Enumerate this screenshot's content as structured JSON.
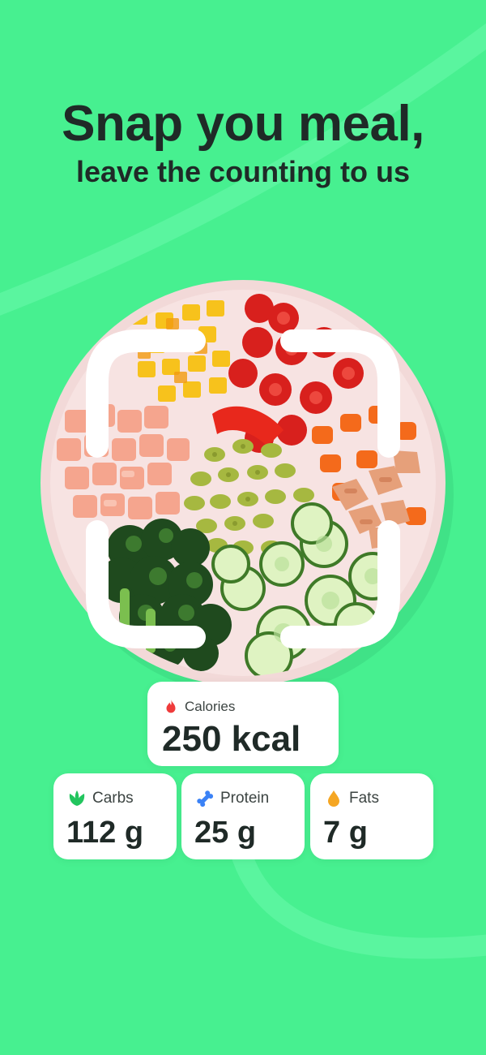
{
  "headline": {
    "line1": "Snap you meal,",
    "line2": "leave the counting to us"
  },
  "calories": {
    "label": "Calories",
    "value": "250 kcal",
    "icon": "flame-icon"
  },
  "macros": [
    {
      "label": "Carbs",
      "value": "112 g",
      "icon": "leaf-icon",
      "color": "#22c55e"
    },
    {
      "label": "Protein",
      "value": "25 g",
      "icon": "bone-icon",
      "color": "#3b82f6"
    },
    {
      "label": "Fats",
      "value": "7 g",
      "icon": "drop-icon",
      "color": "#f5a623"
    }
  ],
  "colors": {
    "background": "#47f090",
    "text": "#1f2a27",
    "card": "#ffffff",
    "calorie_icon": "#ef3b3b"
  }
}
